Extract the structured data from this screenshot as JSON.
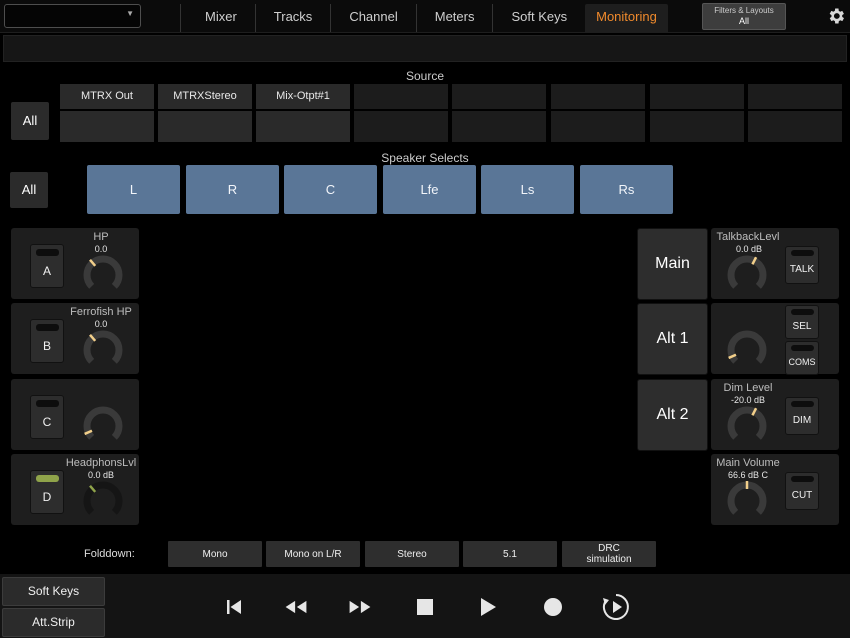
{
  "top_select": {
    "value": ""
  },
  "nav_tabs": [
    {
      "label": "Mixer"
    },
    {
      "label": "Tracks"
    },
    {
      "label": "Channel"
    },
    {
      "label": "Meters"
    },
    {
      "label": "Soft Keys"
    },
    {
      "label": "Monitoring",
      "active": true
    }
  ],
  "filters": {
    "title": "Filters & Layouts",
    "value": "All"
  },
  "source": {
    "label": "Source",
    "all_label": "All",
    "items": [
      "MTRX Out",
      "MTRXStereo",
      "Mix-Otpt#1",
      "",
      "",
      "",
      "",
      ""
    ]
  },
  "speakers": {
    "label": "Speaker Selects",
    "all_label": "All",
    "items": [
      "L",
      "R",
      "C",
      "Lfe",
      "Ls",
      "Rs"
    ]
  },
  "cues": [
    {
      "button": "A",
      "name": "HP",
      "value": "0.0",
      "led_on": false,
      "knob_level": 0.35
    },
    {
      "button": "B",
      "name": "Ferrofish HP",
      "value": "0.0",
      "led_on": false,
      "knob_level": 0.35
    },
    {
      "button": "C",
      "name": "",
      "value": "",
      "led_on": false,
      "knob_level": 0.08
    },
    {
      "button": "D",
      "name": "HeadphonsLvl",
      "value": "0.0 dB",
      "led_on": true,
      "knob_level": 0.35
    }
  ],
  "monitors": [
    {
      "label": "Main"
    },
    {
      "label": "Alt 1"
    },
    {
      "label": "Alt 2"
    }
  ],
  "controls": {
    "talkback": {
      "name": "TalkbackLevl",
      "value": "0.0 dB",
      "button": "TALK",
      "knob_level": 0.6
    },
    "sel_coms": {
      "sel": "SEL",
      "coms": "COMS",
      "knob_level": 0.08
    },
    "dim": {
      "name": "Dim Level",
      "value": "-20.0 dB",
      "button": "DIM",
      "knob_level": 0.6
    },
    "main_volume": {
      "name": "Main Volume",
      "value": "66.6 dB C",
      "button": "CUT",
      "knob_level": 0.5
    }
  },
  "folddown": {
    "label": "Folddown:",
    "options": [
      "Mono",
      "Mono on L/R",
      "Stereo",
      "5.1",
      "DRC\nsimulation"
    ]
  },
  "bottom": {
    "soft_keys": "Soft Keys",
    "att_strip": "Att.Strip"
  },
  "colors": {
    "accent": "#f08a2c",
    "speaker_blue": "#5a7697",
    "knob_indicator": "#f2cf8a",
    "led_green": "#8fa34a"
  }
}
